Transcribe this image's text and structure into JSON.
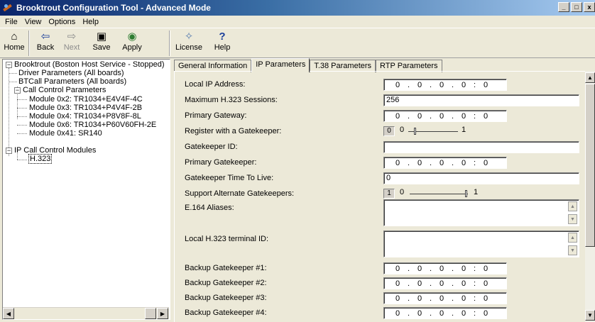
{
  "window": {
    "title": "Brooktrout Configuration Tool - Advanced Mode",
    "controls": [
      "_",
      "□",
      "x"
    ]
  },
  "menu": [
    "File",
    "View",
    "Options",
    "Help"
  ],
  "toolbar": {
    "home": "Home",
    "back": "Back",
    "next": "Next",
    "save": "Save",
    "apply": "Apply",
    "license": "License",
    "help": "Help"
  },
  "tree": {
    "root": "Brooktrout (Boston Host Service - Stopped)",
    "driver": "Driver Parameters (All boards)",
    "btcall": "BTCall Parameters (All boards)",
    "call_control": "Call Control Parameters",
    "modules": [
      "Module 0x2: TR1034+E4V4F-4C",
      "Module 0x3: TR1034+P4V4F-2B",
      "Module 0x4: TR1034+P8V8F-8L",
      "Module 0x6: TR1034+P60V60FH-2E",
      "Module 0x41: SR140"
    ],
    "ip_call_control": "IP Call Control Modules",
    "h323": "H.323"
  },
  "tabs": [
    "General Information",
    "IP Parameters",
    "T.38 Parameters",
    "RTP Parameters"
  ],
  "active_tab": "IP Parameters",
  "form": {
    "local_ip": {
      "label": "Local IP Address:",
      "octets": [
        "0",
        "0",
        "0",
        "0"
      ],
      "port": "0"
    },
    "max_sessions": {
      "label": "Maximum H.323 Sessions:",
      "value": "256"
    },
    "primary_gateway": {
      "label": "Primary Gateway:",
      "octets": [
        "0",
        "0",
        "0",
        "0"
      ],
      "port": "0"
    },
    "register_gk": {
      "label": "Register with a Gatekeeper:",
      "value": "0",
      "min": "0",
      "max": "1"
    },
    "gatekeeper_id": {
      "label": "Gatekeeper ID:",
      "value": ""
    },
    "primary_gk": {
      "label": "Primary Gatekeeper:",
      "octets": [
        "0",
        "0",
        "0",
        "0"
      ],
      "port": "0"
    },
    "gk_ttl": {
      "label": "Gatekeeper Time To Live:",
      "value": "0"
    },
    "alt_gk": {
      "label": "Support Alternate Gatekeepers:",
      "value": "1",
      "min": "0",
      "max": "1"
    },
    "e164": {
      "label": "E.164 Aliases:",
      "value": ""
    },
    "terminal_id": {
      "label": "Local H.323 terminal ID:",
      "value": ""
    },
    "backup_gks": [
      {
        "label": "Backup Gatekeeper #1:",
        "octets": [
          "0",
          "0",
          "0",
          "0"
        ],
        "port": "0"
      },
      {
        "label": "Backup Gatekeeper #2:",
        "octets": [
          "0",
          "0",
          "0",
          "0"
        ],
        "port": "0"
      },
      {
        "label": "Backup Gatekeeper #3:",
        "octets": [
          "0",
          "0",
          "0",
          "0"
        ],
        "port": "0"
      },
      {
        "label": "Backup Gatekeeper #4:",
        "octets": [
          "0",
          "0",
          "0",
          "0"
        ],
        "port": "0"
      }
    ]
  }
}
